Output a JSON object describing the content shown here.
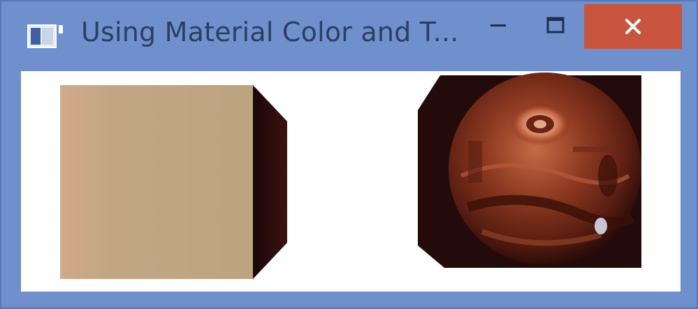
{
  "window": {
    "title": "Using Material Color and T...",
    "colors": {
      "frame": "#6f90cc",
      "title_text": "#2c3f63",
      "close_button": "#c8553d",
      "client_background": "#ffffff"
    },
    "controls": {
      "minimize_icon": "minimize-icon",
      "maximize_icon": "maximize-icon",
      "close_icon": "close-icon"
    }
  },
  "scene": {
    "colored_box": {
      "front_color": "#bfa582",
      "side_color": "#2a0c0c"
    },
    "textured_box": {
      "background_color": "#230b0b",
      "sphere_color": "#8a3a20"
    }
  }
}
